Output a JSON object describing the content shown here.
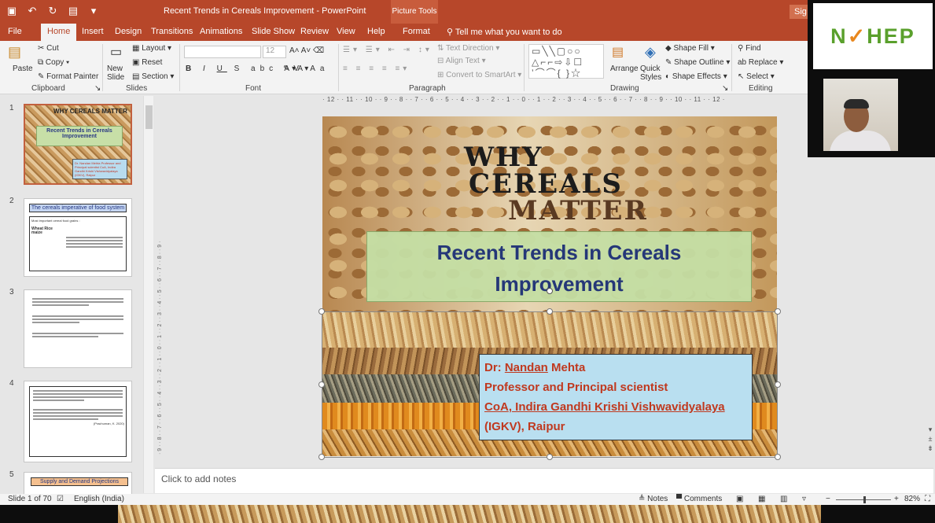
{
  "app": {
    "doc_title": "Recent Trends in Cereals Improvement  -  PowerPoint",
    "picture_tools": "Picture Tools",
    "signin": "Sig"
  },
  "tabs": [
    {
      "label": "File"
    },
    {
      "label": "Home"
    },
    {
      "label": "Insert"
    },
    {
      "label": "Design"
    },
    {
      "label": "Transitions"
    },
    {
      "label": "Animations"
    },
    {
      "label": "Slide Show"
    },
    {
      "label": "Review"
    },
    {
      "label": "View"
    },
    {
      "label": "Help"
    },
    {
      "label": "Format"
    }
  ],
  "tell_me": "Tell me what you want to do",
  "ribbon": {
    "clipboard": {
      "paste": "Paste",
      "cut": "Cut",
      "copy": "Copy",
      "format_painter": "Format Painter",
      "label": "Clipboard"
    },
    "slides": {
      "new_slide": "New Slide",
      "layout": "Layout",
      "reset": "Reset",
      "section": "Section",
      "label": "Slides"
    },
    "font": {
      "size": "12",
      "label": "Font"
    },
    "paragraph": {
      "text_direction": "Text Direction",
      "align_text": "Align Text",
      "convert_smartart": "Convert to SmartArt",
      "label": "Paragraph"
    },
    "drawing": {
      "arrange": "Arrange",
      "quick_styles": "Quick Styles",
      "shape_fill": "Shape Fill",
      "shape_outline": "Shape Outline",
      "shape_effects": "Shape Effects",
      "label": "Drawing"
    },
    "editing": {
      "find": "Find",
      "replace": "Replace",
      "select": "Select",
      "label": "Editing"
    }
  },
  "video": {
    "logo_left": "N",
    "logo_mid": "HEP"
  },
  "thumbnails": [
    {
      "num": "1",
      "why": "WHY CEREALS MATTER",
      "title": "Recent Trends in Cereals Improvement",
      "author": "Dr. Nandan Mehta Professor and Principal scientist CoA, Indira Gandhi Krishi Vishwavidyalaya (IGKV), Raipur"
    },
    {
      "num": "2",
      "head": "The cereals imperative of food system",
      "line1": "Most important cereal food grains :",
      "crops": "Wheat  Rice  maize"
    },
    {
      "num": "3"
    },
    {
      "num": "4",
      "cite": "(Prachuman, K. 2020)"
    },
    {
      "num": "5",
      "head": "Supply and Demand Projections"
    }
  ],
  "ruler": {
    "horizontal": "· 12 · · 11 · · 10 · · 9 · · 8 · · 7 · · 6 · · 5 · · 4 · · 3 · · 2 · · 1 · · 0 · · 1 · · 2 · · 3 · · 4 · · 5 · · 6 · · 7 · · 8 · · 9 · · 10 · · 11 · · 12 ·",
    "vertical": "· 9 · · 8 · · 7 · · 6 · · 5 · · 4 · · 3 · · 2 · · 1 · · 0 · · 1 · · 2 · · 3 · · 4 · · 5 · · 6 · · 7 · · 8 · · 9 ·"
  },
  "slide": {
    "why1": "WHY",
    "why2": "CEREALS",
    "why3": "MATTER",
    "title_line1": "Recent Trends in Cereals",
    "title_line2": "Improvement",
    "author_prefix": "Dr: ",
    "author_name": "Nandan",
    "author_surname": " Mehta",
    "position": "Professor and Principal scientist",
    "inst_prefix": "CoA",
    "inst_rest": ", Indira Gandhi Krishi Vishwavidyalaya",
    "inst_line2": "(IGKV), Raipur"
  },
  "notes": {
    "placeholder": "Click to add notes"
  },
  "status": {
    "slide": "Slide 1 of 70",
    "language": "English (India)",
    "notes_btn": "Notes",
    "comments_btn": "Comments",
    "zoom": "82%"
  },
  "colors": {
    "accent": "#b7472a",
    "title_text": "#253778",
    "author_text": "#c0391f"
  }
}
